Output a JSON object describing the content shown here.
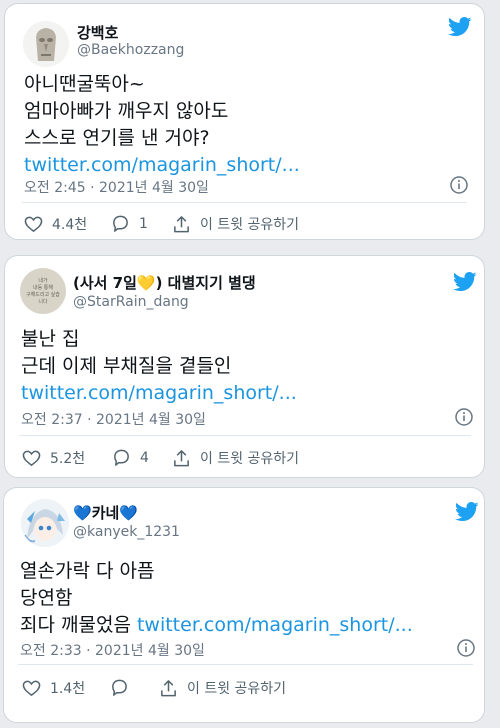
{
  "tweets": [
    {
      "name": "강백호",
      "handle": "@Baekhozzang",
      "lines": [
        "아니땐굴뚝아~",
        "엄마아빠가 깨우지 않아도",
        "스스로 연기를 낸 거야?"
      ],
      "link": "twitter.com/magarin_short/...",
      "meta": "오전 2:45 · 2021년 4월 30일",
      "likes": "4.4천",
      "replies": "1",
      "share": "이 트윗 공유하기"
    },
    {
      "name_prefix": "(사서 7일",
      "name_suffix": ") 대별지기 별댕",
      "name_heart": "💛",
      "handle": "@StarRain_dang",
      "lines": [
        "불난 집",
        "근데 이제 부채질을 곁들인"
      ],
      "link": "twitter.com/magarin_short/...",
      "meta": "오전 2:37 · 2021년 4월 30일",
      "likes": "5.2천",
      "replies": "4",
      "share": "이 트윗 공유하기",
      "avatar_text": "내가\n내등 통해\n구해드리고 싶습니다"
    },
    {
      "name": "카네",
      "name_heart": "💙",
      "handle": "@kanyek_1231",
      "lines": [
        "열손가락 다 아픔",
        "당연함"
      ],
      "line3_prefix": "죄다 깨물었음 ",
      "link": "twitter.com/magarin_short/...",
      "meta": "오전 2:33 · 2021년 4월 30일",
      "likes": "1.4천",
      "share": "이 트윗 공유하기"
    }
  ],
  "colors": {
    "twitter_blue": "#1da1f2",
    "link": "#1b95e0",
    "meta": "#687684"
  }
}
